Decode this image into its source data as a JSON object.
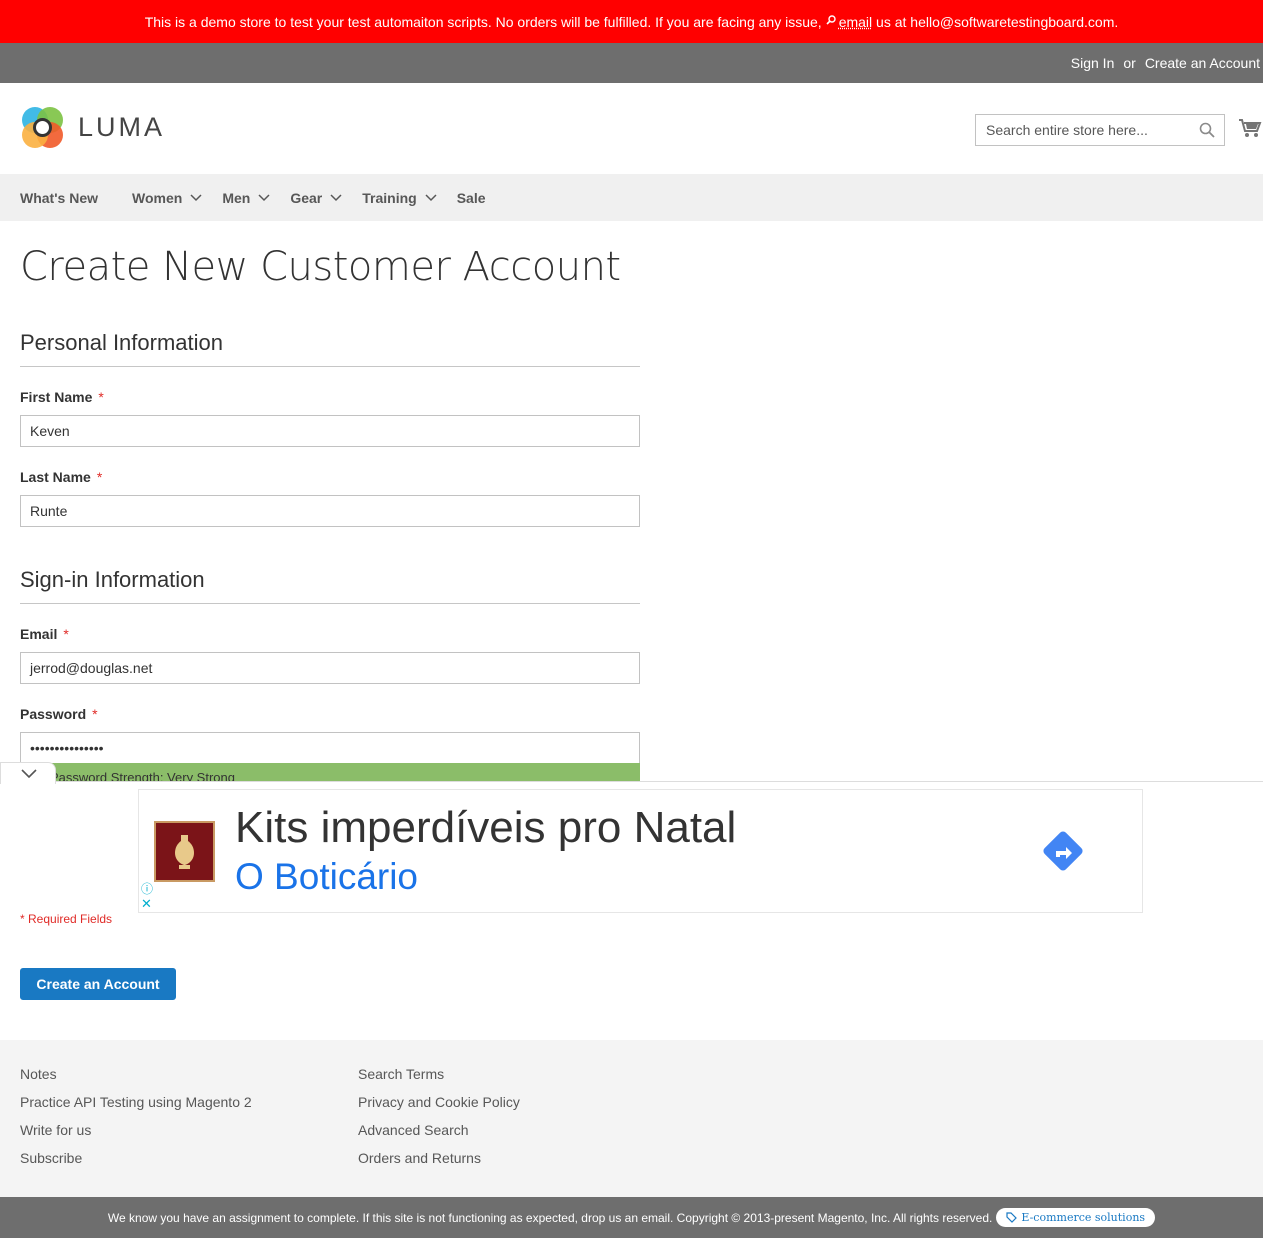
{
  "notice": {
    "text_before": "This is a demo store to test your test automaiton scripts. No orders will be fulfilled. If you are facing any issue,",
    "email_link": "email",
    "text_after": "us at hello@softwaretestingboard.com."
  },
  "panel": {
    "sign_in": "Sign In",
    "or": "or",
    "create_account": "Create an Account"
  },
  "header": {
    "logo_text": "LUMA",
    "search_placeholder": "Search entire store here..."
  },
  "nav": {
    "items": [
      {
        "label": "What's New"
      },
      {
        "label": "Women"
      },
      {
        "label": "Men"
      },
      {
        "label": "Gear"
      },
      {
        "label": "Training"
      },
      {
        "label": "Sale"
      }
    ]
  },
  "page": {
    "title": "Create New Customer Account"
  },
  "form": {
    "personal_legend": "Personal Information",
    "first_name_label": "First Name",
    "first_name_value": "Keven",
    "last_name_label": "Last Name",
    "last_name_value": "Runte",
    "signin_legend": "Sign-in Information",
    "email_label": "Email",
    "email_value": "jerrod@douglas.net",
    "password_label": "Password",
    "password_value": "•••••••••••••••",
    "strength_text": "Password Strength: Very Strong",
    "required_marker": "*",
    "required_note": "* Required Fields",
    "submit_label": "Create an Account"
  },
  "ad": {
    "headline": "Kits imperdíveis pro Natal",
    "brand": "O Boticário",
    "info_icon": "info-icon",
    "close_icon": "close-icon"
  },
  "footer": {
    "col1": [
      "Notes",
      "Practice API Testing using Magento 2",
      "Write for us",
      "Subscribe"
    ],
    "col2": [
      "Search Terms",
      "Privacy and Cookie Policy",
      "Advanced Search",
      "Orders and Returns"
    ],
    "copyright": "We know you have an assignment to complete. If this site is not functioning as expected, drop us an email. Copyright © 2013-present Magento, Inc. All rights reserved.",
    "badge": "E-commerce solutions"
  },
  "colors": {
    "notice_bg": "#ff0000",
    "panel_bg": "#6e6e6e",
    "primary_button": "#1979c3",
    "strength_bar": "#8bbd69",
    "required": "#e02b27"
  }
}
